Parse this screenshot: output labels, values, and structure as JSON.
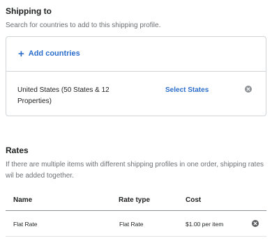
{
  "shipping": {
    "title": "Shipping to",
    "description": "Search for countries to add to this shipping profile.",
    "add_countries_label": "Add countries",
    "country_line": "United States (50 States & 12 Properties)",
    "select_states_label": "Select States"
  },
  "rates": {
    "title": "Rates",
    "description": "If there are multiple items with different shipping profiles in one order, shipping rates wil be added together.",
    "columns": [
      "Name",
      "Rate type",
      "Cost"
    ],
    "rows": [
      {
        "name": "Flat Rate",
        "rate_type": "Flat Rate",
        "cost": "$1.00 per item"
      }
    ]
  },
  "colors": {
    "link": "#2c6ecb",
    "icon_gray": "#8c9196",
    "icon_dark": "#5c5f62"
  }
}
